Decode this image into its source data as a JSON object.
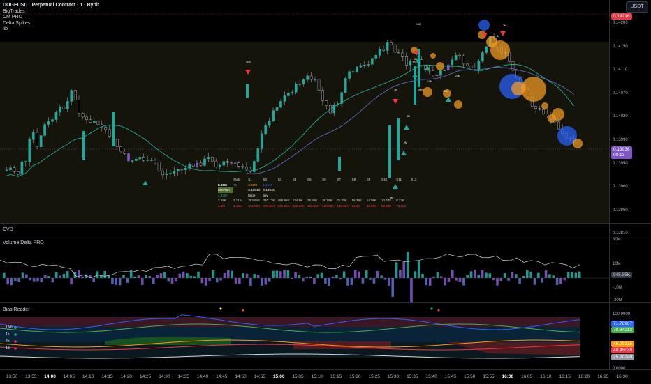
{
  "symbol_title": "DOGEUSDT Perpetual Contract · 1 · Bybit",
  "indicators": [
    "BigTrades",
    "CM PRO",
    "Delta Spikes",
    "lib"
  ],
  "currency": "USDT",
  "price_axis": {
    "ticks": [
      "0.14200",
      "0.14150",
      "0.14110",
      "0.14070",
      "0.14030",
      "0.13990",
      "0.13950",
      "0.13900",
      "0.13860",
      "0.13810"
    ],
    "top_label": "0.14216",
    "current_price": "0.13936",
    "countdown": "00:13"
  },
  "stats_table": {
    "header": [
      "Stats",
      "S1",
      "S2",
      "S3",
      "S4",
      "S5",
      "S6",
      "S7",
      "S8",
      "S9",
      "S10",
      "S11",
      "S12"
    ],
    "row1": [
      "8.06M",
      "72",
      "3.31M",
      "1.15M"
    ],
    "row2": [
      "618.75K",
      "0.1394B",
      "0.13945"
    ],
    "row3": [
      "4.43M",
      "large",
      "tiny"
    ],
    "row4": [
      "3.16K",
      "3.31K",
      "353.84K",
      "350.12K",
      "166.99K",
      "134.9K",
      "26.49K",
      "26.16K",
      "21.78K",
      "15.29K",
      "14.98K",
      "10.54K",
      "8.22K"
    ],
    "row5": [
      "1.8M",
      "1.13M",
      "572.55K",
      "446.24K",
      "231.06K",
      "220.28K",
      "183.26K",
      "180.65K",
      "180.23K",
      "91.4K",
      "83.89K",
      "82.35K",
      "76.73K"
    ]
  },
  "candle_labels": [
    "10M",
    "7M",
    "3M",
    "19M",
    "4M",
    "2M",
    "15M",
    "2M",
    "10M",
    "5M",
    "19M",
    "20M"
  ],
  "cvd_title": "CVD",
  "volume_delta": {
    "title": "Volume Delta PRO",
    "ticks": [
      "30M",
      "10M",
      "-10M",
      "-20M"
    ],
    "current": "945.85K"
  },
  "bias_reader": {
    "title": "Bias Reader",
    "ticks": [
      "100.0000",
      "0.0000"
    ],
    "labels": [
      {
        "value": "71.78967",
        "color": "#2962ff"
      },
      {
        "value": "70.84213",
        "color": "#4caf50"
      },
      {
        "value": "46.09335",
        "color": "#ff9800"
      },
      {
        "value": "40.45039",
        "color": "#f23645"
      },
      {
        "value": "25.20240",
        "color": "#9598a1"
      }
    ],
    "timeframes": [
      "15m",
      "1h",
      "4h",
      "1d"
    ]
  },
  "time_axis": [
    "13:50",
    "13:55",
    "14:00",
    "14:05",
    "14:10",
    "14:15",
    "14:20",
    "14:25",
    "14:30",
    "14:35",
    "14:40",
    "14:45",
    "14:50",
    "14:55",
    "15:00",
    "15:05",
    "15:10",
    "15:15",
    "15:20",
    "15:25",
    "15:30",
    "15:35",
    "15:40",
    "15:45",
    "15:50",
    "15:55",
    "16:00",
    "16:05",
    "16:10",
    "16:15",
    "16:20",
    "16:25",
    "16:30"
  ],
  "colors": {
    "up": "#26a69a",
    "down": "#787b86",
    "accent": "#7e57c2",
    "bubble_orange": "#f59d23",
    "bubble_blue": "#2962ff"
  }
}
